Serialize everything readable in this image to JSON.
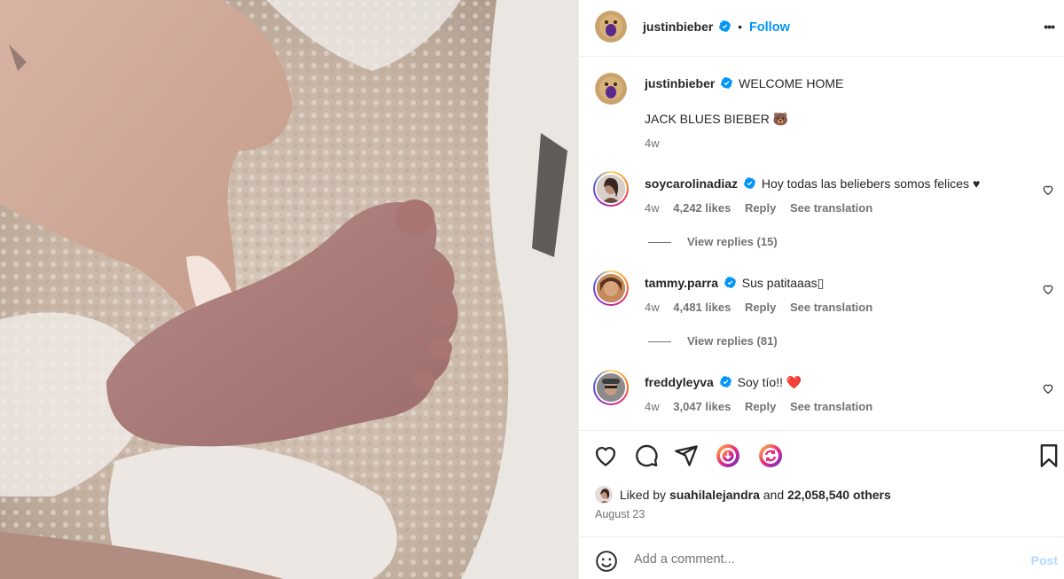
{
  "post": {
    "author": "justinbieber",
    "follow_label": "Follow",
    "separator": "•",
    "more_label": "•••",
    "caption_line1": "WELCOME HOME",
    "caption_line2": "JACK BLUES BIEBER 🐻",
    "caption_time": "4w"
  },
  "comments": [
    {
      "username": "soycarolinadiaz",
      "text": "Hoy todas las beliebers somos felices ♥",
      "time": "4w",
      "likes": "4,242 likes",
      "reply_label": "Reply",
      "translate_label": "See translation",
      "view_replies": "View replies (15)"
    },
    {
      "username": "tammy.parra",
      "text": "Sus patitaaas▯",
      "time": "4w",
      "likes": "4,481 likes",
      "reply_label": "Reply",
      "translate_label": "See translation",
      "view_replies": "View replies (81)"
    },
    {
      "username": "freddyleyva",
      "text": "Soy tío!! ❤️",
      "time": "4w",
      "likes": "3,047 likes",
      "reply_label": "Reply",
      "translate_label": "See translation"
    }
  ],
  "likes_summary": {
    "prefix": "Liked by",
    "liked_user": "suahilalejandra",
    "connector": "and",
    "others": "22,058,540 others"
  },
  "post_date": "August 23",
  "add_comment": {
    "placeholder": "Add a comment...",
    "post_label": "Post"
  },
  "icons": {
    "like": "heart-icon",
    "comment": "comment-icon",
    "share": "send-icon",
    "reels_1": "reel-share-icon",
    "reels_2": "remix-icon",
    "save": "bookmark-icon",
    "emoji": "emoji-icon",
    "verified": "verified-badge-icon",
    "more": "more-options-icon"
  },
  "colors": {
    "accent_blue": "#0095f6",
    "post_disabled": "#b3dbff",
    "muted_text": "#737373",
    "verified_blue": "#0095f6",
    "heart_red": "#e0245e"
  }
}
